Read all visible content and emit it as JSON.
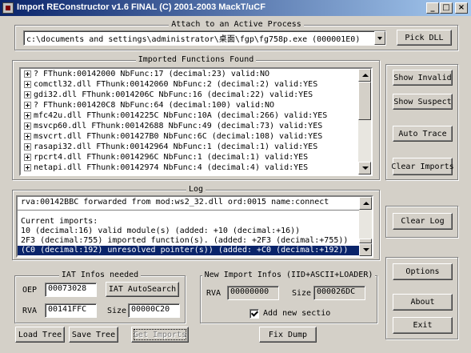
{
  "window": {
    "title": "Import REConstructor v1.6 FINAL (C) 2001-2003 MackT/uCF",
    "min_label": "_",
    "max_label": "□",
    "close_label": "×"
  },
  "attach": {
    "group_label": "Attach to an Active Process",
    "process_value": "c:\\documents and settings\\administrator\\桌面\\fgp\\fg758p.exe (000001E0)",
    "pick_dll_label": "Pick DLL"
  },
  "imports": {
    "group_label": "Imported Functions Found",
    "items": [
      {
        "text": "? FThunk:00142000 NbFunc:17 (decimal:23) valid:NO"
      },
      {
        "text": "comctl32.dll FThunk:00142060 NbFunc:2 (decimal:2) valid:YES"
      },
      {
        "text": "gdi32.dll FThunk:0014206C NbFunc:16 (decimal:22) valid:YES"
      },
      {
        "text": "? FThunk:001420C8 NbFunc:64 (decimal:100) valid:NO"
      },
      {
        "text": "mfc42u.dll FThunk:0014225C NbFunc:10A (decimal:266) valid:YES"
      },
      {
        "text": "msvcp60.dll FThunk:00142688 NbFunc:49 (decimal:73) valid:YES"
      },
      {
        "text": "msvcrt.dll FThunk:001427B0 NbFunc:6C (decimal:108) valid:YES"
      },
      {
        "text": "rasapi32.dll FThunk:00142964 NbFunc:1 (decimal:1) valid:YES"
      },
      {
        "text": "rpcrt4.dll FThunk:0014296C NbFunc:1 (decimal:1) valid:YES"
      },
      {
        "text": "netapi.dll FThunk:00142974 NbFunc:4 (decimal:4) valid:YES"
      }
    ]
  },
  "side_buttons": {
    "show_invalid": "Show Invalid",
    "show_suspect": "Show Suspect",
    "auto_trace": "Auto Trace",
    "clear_imports": "Clear Imports",
    "clear_log": "Clear Log",
    "options": "Options",
    "about": "About",
    "exit": "Exit"
  },
  "log": {
    "group_label": "Log",
    "lines": [
      {
        "text": "rva:00142BBC forwarded from mod:ws2_32.dll ord:0015 name:connect"
      },
      {
        "text": ""
      },
      {
        "text": "Current imports:"
      },
      {
        "text": "10 (decimal:16) valid module(s) (added: +10 (decimal:+16))"
      },
      {
        "text": "2F3 (decimal:755) imported function(s). (added: +2F3 (decimal:+755))"
      },
      {
        "text": "(C0 (decimal:192) unresolved pointer(s)) (added: +C0 (decimal:+192))"
      }
    ]
  },
  "iat": {
    "group_label": "IAT Infos needed",
    "oep_label": "OEP",
    "oep_value": "00073028",
    "autosearch_label": "IAT AutoSearch",
    "rva_label": "RVA",
    "rva_value": "00141FFC",
    "size_label": "Size",
    "size_value": "00000C20"
  },
  "new_import": {
    "group_label": "New Import Infos (IID+ASCII+LOADER)",
    "rva_label": "RVA",
    "rva_value": "00000000",
    "size_label": "Size",
    "size_value": "000026DC",
    "add_section_label": "Add new sectio"
  },
  "bottom_buttons": {
    "load_tree": "Load Tree",
    "save_tree": "Save Tree",
    "get_imports": "Get Imports",
    "fix_dump": "Fix Dump"
  }
}
